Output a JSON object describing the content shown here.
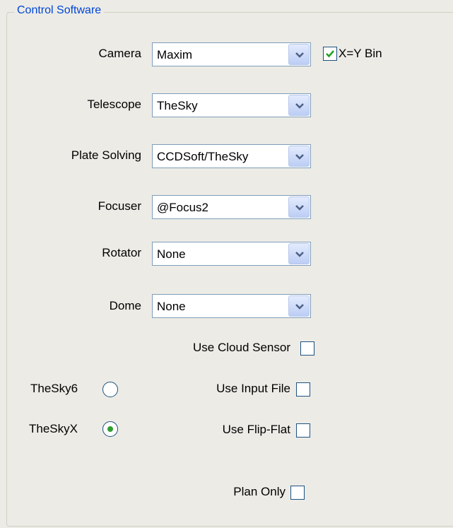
{
  "group": {
    "title": "Control Software"
  },
  "camera": {
    "label": "Camera",
    "value": "Maxim",
    "xy_bin_label": "X=Y Bin",
    "xy_bin_checked": true
  },
  "telescope": {
    "label": "Telescope",
    "value": "TheSky"
  },
  "plate_solving": {
    "label": "Plate Solving",
    "value": "CCDSoft/TheSky"
  },
  "focuser": {
    "label": "Focuser",
    "value": "@Focus2"
  },
  "rotator": {
    "label": "Rotator",
    "value": "None"
  },
  "dome": {
    "label": "Dome",
    "value": "None"
  },
  "options": {
    "cloud_sensor": {
      "label": "Use Cloud Sensor",
      "checked": false
    },
    "input_file": {
      "label": "Use Input File",
      "checked": false
    },
    "flip_flat": {
      "label": "Use Flip-Flat",
      "checked": false
    },
    "plan_only": {
      "label": "Plan Only",
      "checked": false
    }
  },
  "sky_version": {
    "thesky6": {
      "label": "TheSky6",
      "selected": false
    },
    "theskyx": {
      "label": "TheSkyX",
      "selected": true
    }
  },
  "icons": {
    "dropdown": "chevron-down-icon",
    "check": "checkmark-icon"
  },
  "colors": {
    "background": "#ecebe6",
    "group_title": "#0046d5",
    "control_border": "#1c5180",
    "check_green": "#21a121"
  }
}
